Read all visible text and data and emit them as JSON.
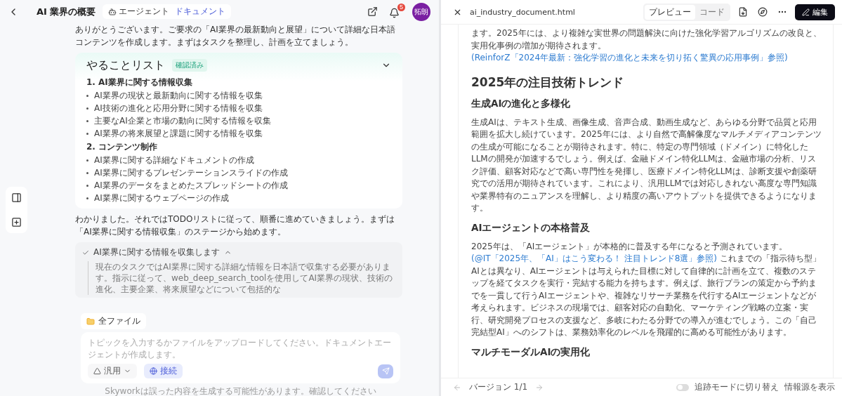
{
  "header": {
    "title": "AI 業界の概要",
    "mode_tabs": [
      {
        "label": "エージェント",
        "selected": false
      },
      {
        "label": "ドキュメント",
        "selected": true
      }
    ],
    "notification_count": "5",
    "avatar": "拓朗"
  },
  "chat": {
    "intro": "ありがとうございます。ご要求の「AI業界の最新動向と展望」について詳細な日本語コンテンツを作成します。まずはタスクを整理し、計画を立てましょう。",
    "todo": {
      "title": "やることリスト",
      "badge": "確認済み",
      "expanded": true,
      "sections": [
        {
          "heading": "1. AI業界に関する情報収集",
          "items": [
            "AI業界の現状と最新動向に関する情報を収集",
            "AI技術の進化と応用分野に関する情報を収集",
            "主要なAI企業と市場の動向に関する情報を収集",
            "AI業界の将来展望と課題に関する情報を収集"
          ]
        },
        {
          "heading": "2. コンテンツ制作",
          "items": [
            "AI業界に関する詳細なドキュメントの作成",
            "AI業界に関するプレゼンテーションスライドの作成",
            "AI業界のデータをまとめたスプレッドシートの作成",
            "AI業界に関するウェブページの作成"
          ]
        }
      ]
    },
    "reply": "わかりました。それではTODOリストに従って、順番に進めていきましょう。まずは「AI業界に関する情報収集」のステージから始めます。",
    "step": {
      "title": "AI業界に関する情報を収集します",
      "done": true,
      "expanded": true,
      "text": "現在のタスクではAI業界に関する詳細な情報を日本語で収集する必要があります。指示に従って、web_deep_search_toolを使用してAI業界の現状、技術の進化、主要企業、将来展望などについて包括的な"
    }
  },
  "composer": {
    "files_chip": "全ファイル",
    "placeholder": "トピックを入力するかファイルをアップロードしてください。ドキュメントエージェントが作成します。",
    "mode": "汎用",
    "connect": "接続"
  },
  "disclaimer": "Skyworkは誤った内容を生成する可能性があります。確認してください",
  "preview": {
    "filename": "ai_industry_document.html",
    "view_tabs": [
      {
        "label": "プレビュー",
        "selected": true
      },
      {
        "label": "コード",
        "selected": false
      }
    ],
    "edit_button": "編集",
    "document": [
      {
        "kind": "p",
        "parts": [
          {
            "kind": "text",
            "text": "ます。2025年には、より複雑な実世界の問題解決に向けた強化学習アルゴリズムの改良と、実用化事例の増加が期待されます。"
          },
          {
            "kind": "link",
            "text": "(ReinforZ「2024年最新：強化学習の進化と未来を切り拓く驚異の応用事例」参照)"
          }
        ]
      },
      {
        "kind": "h2",
        "text": "2025年の注目技術トレンド"
      },
      {
        "kind": "h3",
        "text": "生成AIの進化と多様化"
      },
      {
        "kind": "p",
        "parts": [
          {
            "kind": "text",
            "text": "生成AIは、テキスト生成、画像生成、音声合成、動画生成など、あらゆる分野で品質と応用範囲を拡大し続けています。2025年には、より自然で高解像度なマルチメディアコンテンツの生成が可能になることが期待されます。特に、特定の専門領域（ドメイン）に特化したLLMの開発が加速するでしょう。例えば、金融ドメイン特化LLMは、金融市場の分析、リスク評価、顧客対応などで高い専門性を発揮し、医療ドメイン特化LLMは、診断支援や創薬研究での活用が期待されています。これにより、汎用LLMでは対応しきれない高度な専門知識や業界特有のニュアンスを理解し、より精度の高いアウトプットを提供できるようになります。"
          }
        ]
      },
      {
        "kind": "h3",
        "text": "AIエージェントの本格普及"
      },
      {
        "kind": "p",
        "parts": [
          {
            "kind": "text",
            "text": "2025年は、「AIエージェント」が本格的に普及する年になると予測されています。"
          },
          {
            "kind": "link",
            "text": "(@IT「2025年、「AI」はこう変わる！ 注目トレンド8選」参照)"
          },
          {
            "kind": "text",
            "text": " これまでの「指示待ち型」AIとは異なり、AIエージェントは与えられた目標に対して自律的に計画を立て、複数のステップを経てタスクを実行・完結する能力を持ちます。例えば、旅行プランの策定から予約までを一貫して行うAIエージェントや、複雑なリサーチ業務を代行するAIエージェントなどが考えられます。ビジネスの現場では、顧客対応の自動化、マーケティング戦略の立案・実行、研究開発プロセスの支援など、多岐にわたる分野での導入が進むでしょう。この「自己完結型AI」へのシフトは、業務効率化のレベルを飛躍的に高める可能性があります。"
          }
        ]
      },
      {
        "kind": "h3",
        "text": "マルチモーダルAIの実用化"
      }
    ],
    "footer": {
      "version": "バージョン 1/1",
      "tracking": {
        "label": "追跡モードに切り替え",
        "on": false
      },
      "sources": "情報源を表示"
    }
  }
}
